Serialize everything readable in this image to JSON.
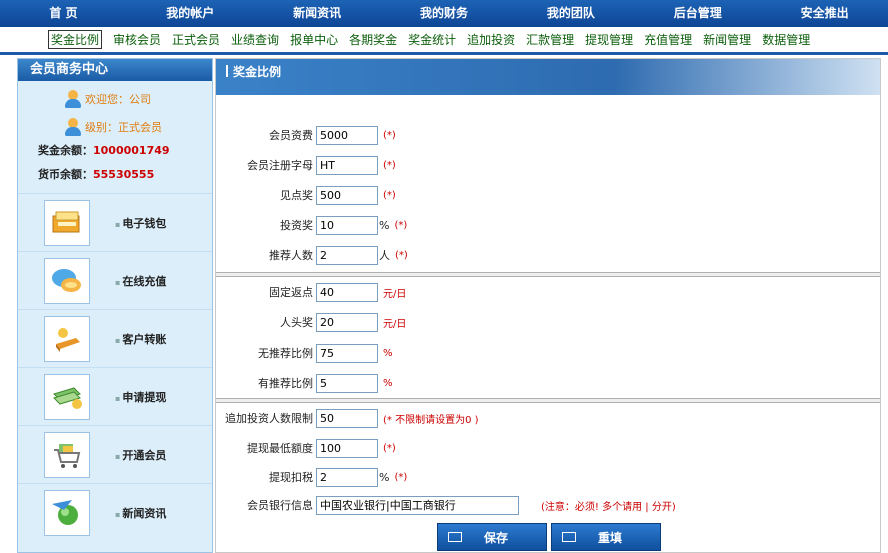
{
  "topnav": [
    "首 页",
    "我的帐户",
    "新闻资讯",
    "我的财务",
    "我的团队",
    "后台管理",
    "安全推出"
  ],
  "subnav": [
    "奖金比例",
    "审核会员",
    "正式会员",
    "业绩查询",
    "报单中心",
    "各期奖金",
    "奖金统计",
    "追加投资",
    "汇款管理",
    "提现管理",
    "充值管理",
    "新闻管理",
    "数据管理"
  ],
  "sidebar": {
    "title": "会员商务中心",
    "welcome": "欢迎您：公司",
    "level": "级别：正式会员",
    "bonus_label": "奖金余额：",
    "bonus_value": "1000001749",
    "currency_label": "货币余额：",
    "currency_value": "55530555",
    "menu": [
      {
        "label": "电子钱包",
        "icon": "wallet-icon"
      },
      {
        "label": "在线充值",
        "icon": "chat-bubbles-icon"
      },
      {
        "label": "客户转账",
        "icon": "gold-bars-icon"
      },
      {
        "label": "申请提现",
        "icon": "cash-stack-icon"
      },
      {
        "label": "开通会员",
        "icon": "shopping-cart-icon"
      },
      {
        "label": "新闻资讯",
        "icon": "globe-arrow-icon"
      }
    ]
  },
  "main": {
    "title": "奖金比例",
    "fields": [
      {
        "label": "会员资费",
        "value": "5000",
        "unit": "",
        "note": "(*)"
      },
      {
        "label": "会员注册字母",
        "value": "HT",
        "unit": "",
        "note": "(*)"
      },
      {
        "label": "见点奖",
        "value": "500",
        "unit": "",
        "note": "(*)"
      },
      {
        "label": "投资奖",
        "value": "10",
        "unit": "%",
        "note": "(*)"
      },
      {
        "label": "推荐人数",
        "value": "2",
        "unit": "人",
        "note": "(*)"
      },
      {
        "label": "固定返点",
        "value": "40",
        "unit": "",
        "note": "元/日"
      },
      {
        "label": "人头奖",
        "value": "20",
        "unit": "",
        "note": "元/日"
      },
      {
        "label": "无推荐比例",
        "value": "75",
        "unit": "",
        "note": "%"
      },
      {
        "label": "有推荐比例",
        "value": "5",
        "unit": "",
        "note": "%"
      },
      {
        "label": "追加投资人数限制",
        "value": "50",
        "unit": "",
        "note": "(* 不限制请设置为0 )"
      },
      {
        "label": "提现最低额度",
        "value": "100",
        "unit": "",
        "note": "(*)"
      },
      {
        "label": "提现扣税",
        "value": "2",
        "unit": "%",
        "note": "(*)"
      },
      {
        "label": "会员银行信息",
        "value": "中国农业银行|中国工商银行",
        "unit": "",
        "note": "(注意：必须! 多个请用 | 分开)"
      }
    ],
    "save_label": "保存",
    "reset_label": "重填"
  }
}
